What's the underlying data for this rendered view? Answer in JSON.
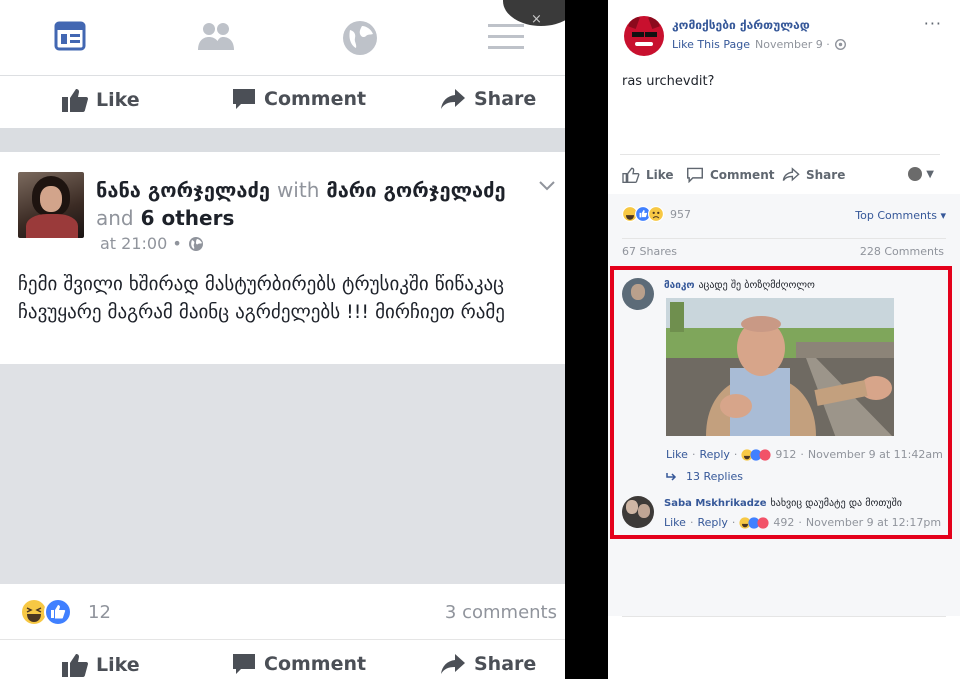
{
  "left": {
    "nav": {
      "icons": [
        "news-feed-icon",
        "friends-icon",
        "globe-icon",
        "menu-icon"
      ],
      "close_glyph": "×"
    },
    "actions": {
      "like": "Like",
      "comment": "Comment",
      "share": "Share"
    },
    "post": {
      "author": "ნანა გორჯელაძე",
      "with_word": "with",
      "tagged": "მარი გორჯელაძე",
      "and_word": "and",
      "others": "6 others",
      "time": "at 21:00 •",
      "text": "ჩემი შვილი ხშირად მასტურბირებს ტრუსიკში წიწაკაც ჩავუყარე მაგრამ მაინც აგრძელებს !!! მირჩიეთ რამე"
    },
    "reactions_count": "12",
    "comments_count": "3 comments"
  },
  "right": {
    "page_name": "კომიქსები ქართულად",
    "like_page": "Like This Page",
    "date": "November 9 ·",
    "more": "···",
    "message": "ras urchevdit?",
    "actions": {
      "like": "Like",
      "comment": "Comment",
      "share": "Share"
    },
    "reactions_count": "957",
    "top_comments": "Top Comments ▾",
    "shares": "67 Shares",
    "comments_total": "228 Comments",
    "comments": [
      {
        "name": "მაიკო",
        "text": "აცადე შე ბოზღმძღოლო",
        "like": "Like",
        "reply": "Reply",
        "count": "912",
        "time": "November 9 at 11:42am"
      },
      {
        "name": "Saba Mskhrikadze",
        "text": "ხახვიც დაუმატე და მოთუში",
        "like": "Like",
        "reply": "Reply",
        "count": "492",
        "time": "November 9 at 12:17pm"
      }
    ],
    "replies": "13 Replies"
  },
  "colors": {
    "fb_blue": "#365899",
    "text_gray": "#90949c",
    "highlight_red": "#e4001b"
  }
}
